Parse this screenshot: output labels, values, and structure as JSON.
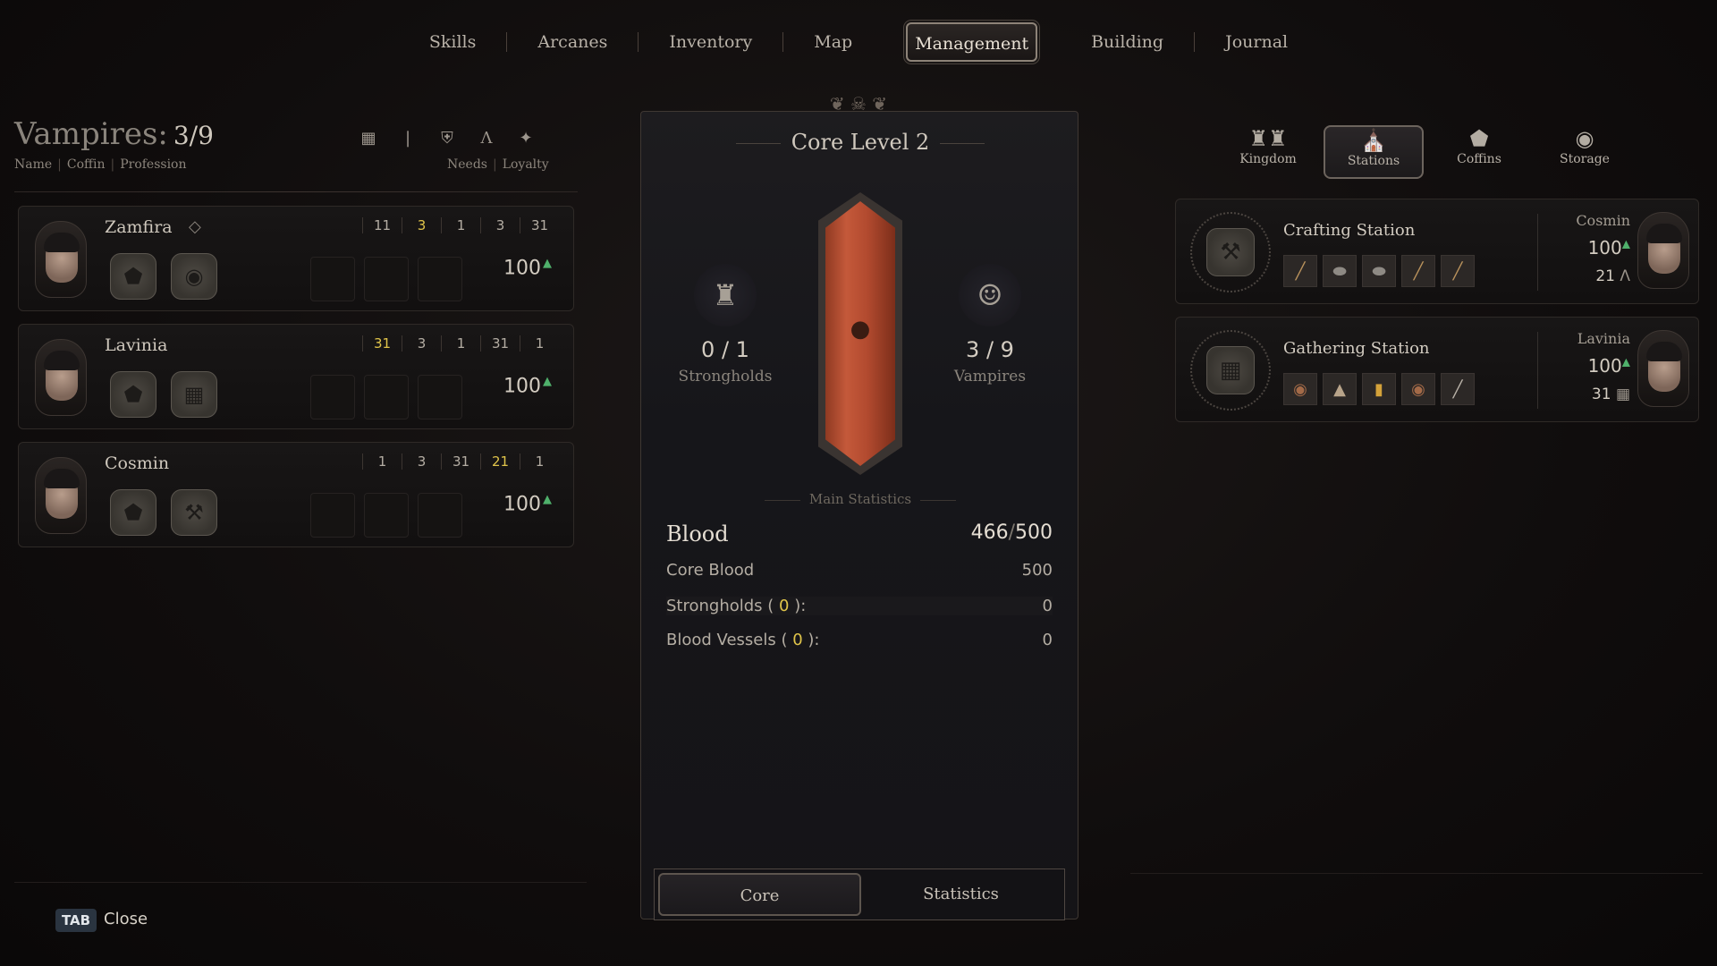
{
  "nav": {
    "tabs": [
      "Skills",
      "Arcanes",
      "Inventory",
      "Map",
      "Management",
      "Building",
      "Journal"
    ],
    "active": "Management"
  },
  "left": {
    "title": "Vampires:",
    "count": "3/9",
    "sub_left": [
      "Name",
      "Coffin",
      "Profession"
    ],
    "sub_right": [
      "Needs",
      "Loyalty"
    ],
    "header_icons": [
      "book-icon",
      "fork-icon",
      "shield-icon",
      "compass-icon",
      "sun-icon"
    ],
    "vampires": [
      {
        "name": "Zamfira",
        "stats": [
          "11",
          "3",
          "1",
          "3",
          "31"
        ],
        "highlight": [
          1
        ],
        "loyalty": "100",
        "slots": [
          "coffin-icon",
          "blood-drop-icon"
        ]
      },
      {
        "name": "Lavinia",
        "stats": [
          "31",
          "3",
          "1",
          "31",
          "1"
        ],
        "highlight": [
          0
        ],
        "loyalty": "100",
        "slots": [
          "coffin-icon",
          "basket-icon"
        ]
      },
      {
        "name": "Cosmin",
        "stats": [
          "1",
          "3",
          "31",
          "21",
          "1"
        ],
        "highlight": [
          3
        ],
        "loyalty": "100",
        "slots": [
          "coffin-icon",
          "pickaxe-icon"
        ]
      }
    ]
  },
  "center": {
    "title": "Core Level",
    "level": "2",
    "strongholds": {
      "value": "0 / 1",
      "label": "Strongholds"
    },
    "vampires": {
      "value": "3 / 9",
      "label": "Vampires"
    },
    "main_stats_label": "Main Statistics",
    "blood_label": "Blood",
    "blood_value": "466",
    "blood_max": "500",
    "rows": [
      {
        "label": "Core Blood",
        "value": "500"
      },
      {
        "label": "Strongholds (",
        "count": "0",
        "label_end": "):",
        "value": "0"
      },
      {
        "label": "Blood Vessels (",
        "count": "0",
        "label_end": "):",
        "value": "0"
      }
    ],
    "tabs": [
      "Core",
      "Statistics"
    ],
    "active_tab": "Core"
  },
  "right": {
    "tabs": [
      {
        "label": "Kingdom",
        "icon": "castle-icon"
      },
      {
        "label": "Stations",
        "icon": "station-icon"
      },
      {
        "label": "Coffins",
        "icon": "coffin-icon"
      },
      {
        "label": "Storage",
        "icon": "sack-icon"
      }
    ],
    "active_tab": "Stations",
    "stations": [
      {
        "name": "Crafting Station",
        "icon": "pickaxe-icon",
        "assignee": "Cosmin",
        "loyalty": "100",
        "skill": "21",
        "skill_icon": "compass-icon"
      },
      {
        "name": "Gathering Station",
        "icon": "basket-icon",
        "assignee": "Lavinia",
        "loyalty": "100",
        "skill": "31",
        "skill_icon": "book-icon"
      }
    ]
  },
  "footer": {
    "key": "TAB",
    "label": "Close"
  },
  "colors": {
    "accent_yellow": "#e0c44a",
    "loyalty_green": "#4fb06b",
    "crystal": "#b24a2f"
  }
}
